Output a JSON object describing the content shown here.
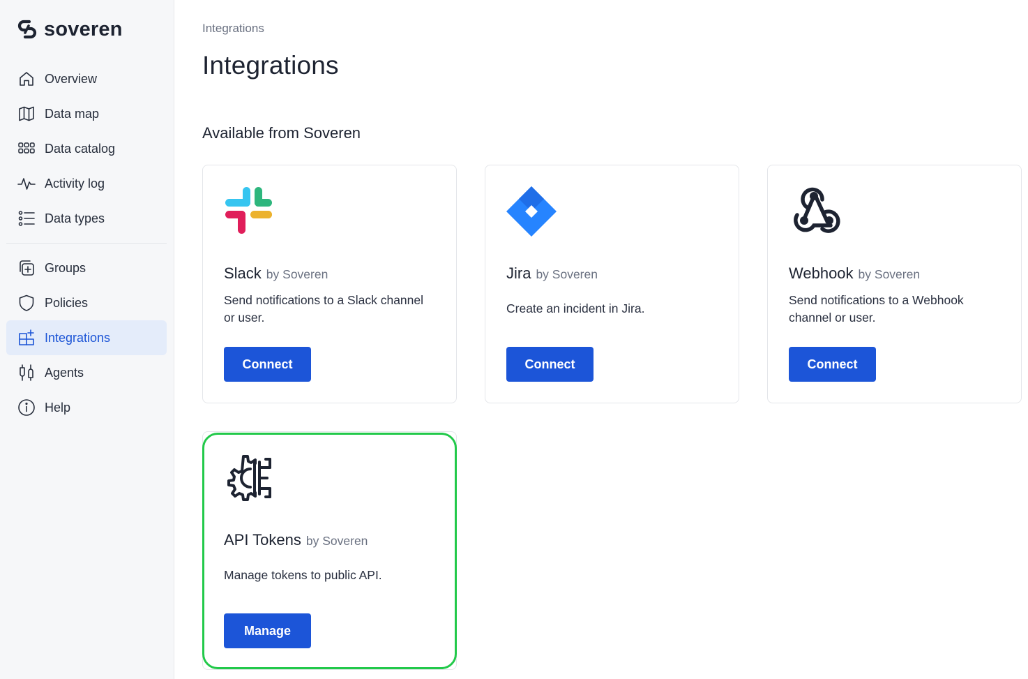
{
  "brand": {
    "name": "soveren"
  },
  "sidebar": {
    "items": [
      {
        "label": "Overview",
        "icon": "home-icon"
      },
      {
        "label": "Data map",
        "icon": "map-icon"
      },
      {
        "label": "Data catalog",
        "icon": "grid-icon"
      },
      {
        "label": "Activity log",
        "icon": "activity-icon"
      },
      {
        "label": "Data types",
        "icon": "list-icon"
      },
      {
        "label": "Groups",
        "icon": "groups-icon"
      },
      {
        "label": "Policies",
        "icon": "shield-icon"
      },
      {
        "label": "Integrations",
        "icon": "integrations-icon",
        "active": true
      },
      {
        "label": "Agents",
        "icon": "agents-icon"
      },
      {
        "label": "Help",
        "icon": "info-icon"
      }
    ]
  },
  "breadcrumb": "Integrations",
  "page_title": "Integrations",
  "section_title": "Available from Soveren",
  "cards": [
    {
      "name": "Slack",
      "by": "by Soveren",
      "description": "Send notifications to a Slack channel or user.",
      "button": "Connect",
      "icon": "slack-icon"
    },
    {
      "name": "Jira",
      "by": "by Soveren",
      "description": "Create an incident in Jira.",
      "button": "Connect",
      "icon": "jira-icon"
    },
    {
      "name": "Webhook",
      "by": "by Soveren",
      "description": "Send notifications to a Webhook channel or user.",
      "button": "Connect",
      "icon": "webhook-icon"
    },
    {
      "name": "API Tokens",
      "by": "by Soveren",
      "description": "Manage tokens to public API.",
      "button": "Manage",
      "icon": "api-gear-icon"
    }
  ],
  "colors": {
    "accent": "#1c55d8",
    "active_bg": "#e4ecfa",
    "highlight": "#22c94a",
    "sidebar_bg": "#f6f7f9"
  }
}
